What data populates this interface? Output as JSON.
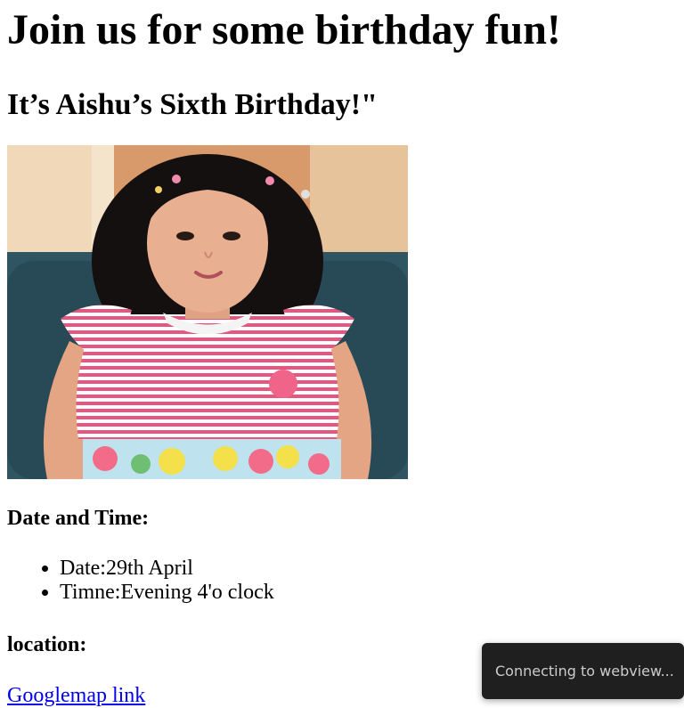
{
  "page": {
    "title": "Join us for some birthday fun!",
    "subtitle": "It’s Aishu’s Sixth Birthday!\""
  },
  "photo": {
    "subject": "girl-portrait",
    "colors": {
      "background_wall": "#d89a6a",
      "chair": "#2f5562",
      "hair": "#141010",
      "skin": "#e8b090",
      "dress_stripe": "#e8557f",
      "dress_base": "#ffffff"
    }
  },
  "event": {
    "date_time_heading": "Date and Time:",
    "details": [
      {
        "text": "Date:29th April"
      },
      {
        "text": "Timne:Evening 4'o clock"
      }
    ],
    "location_heading": "location:",
    "map_link": "Googlemap link"
  },
  "toast": {
    "message": "Connecting to webview..."
  },
  "colors": {
    "link": "#0000ee",
    "toast_bg": "#1f1f1f",
    "toast_text": "#cccccc"
  }
}
